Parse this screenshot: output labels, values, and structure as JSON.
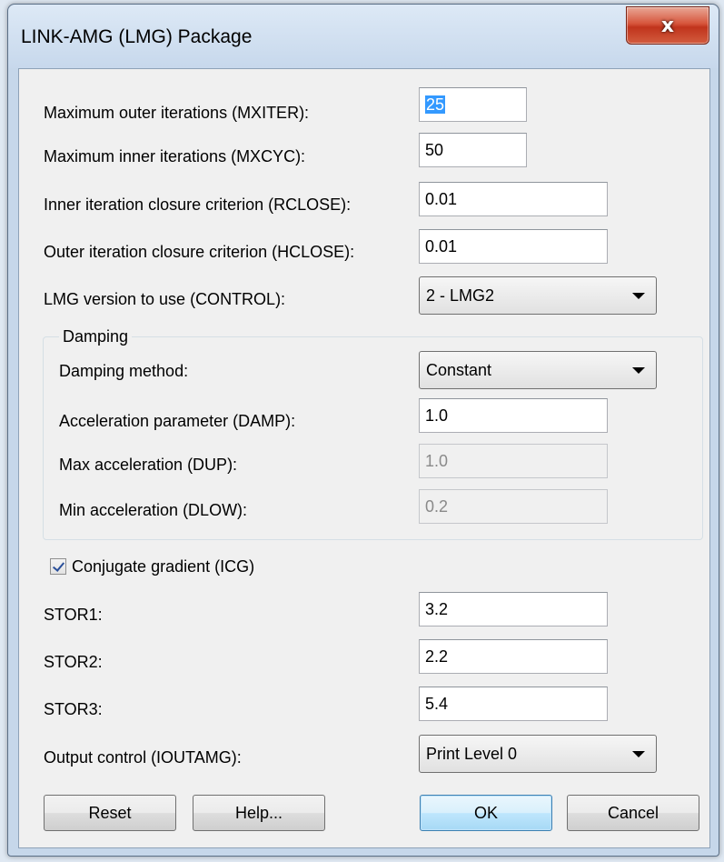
{
  "window": {
    "title": "LINK-AMG (LMG) Package",
    "close_glyph": "x"
  },
  "fields": {
    "mxiter": {
      "label": "Maximum outer iterations (MXITER):",
      "value": "25"
    },
    "mxcyc": {
      "label": "Maximum inner iterations (MXCYC):",
      "value": "50"
    },
    "rclose": {
      "label": "Inner iteration closure criterion (RCLOSE):",
      "value": "0.01"
    },
    "hclose": {
      "label": "Outer iteration closure criterion (HCLOSE):",
      "value": "0.01"
    },
    "control": {
      "label": "LMG version to use (CONTROL):",
      "value": "2 - LMG2"
    }
  },
  "damping": {
    "group_title": "Damping",
    "method": {
      "label": "Damping method:",
      "value": "Constant"
    },
    "damp": {
      "label": "Acceleration parameter (DAMP):",
      "value": "1.0"
    },
    "dup": {
      "label": "Max acceleration (DUP):",
      "value": "1.0",
      "enabled": false
    },
    "dlow": {
      "label": "Min acceleration (DLOW):",
      "value": "0.2",
      "enabled": false
    }
  },
  "icg": {
    "label": "Conjugate gradient (ICG)",
    "checked": true
  },
  "stor": {
    "stor1": {
      "label": "STOR1:",
      "value": "3.2"
    },
    "stor2": {
      "label": "STOR2:",
      "value": "2.2"
    },
    "stor3": {
      "label": "STOR3:",
      "value": "5.4"
    }
  },
  "ioutamg": {
    "label": "Output control (IOUTAMG):",
    "value": "Print Level 0"
  },
  "buttons": {
    "reset": "Reset",
    "help": "Help...",
    "ok": "OK",
    "cancel": "Cancel"
  },
  "colors": {
    "titlebar": "#c6d7ea",
    "close_button": "#c7452b",
    "selection": "#3399ff",
    "dialog_bg": "#f0f0f0"
  }
}
